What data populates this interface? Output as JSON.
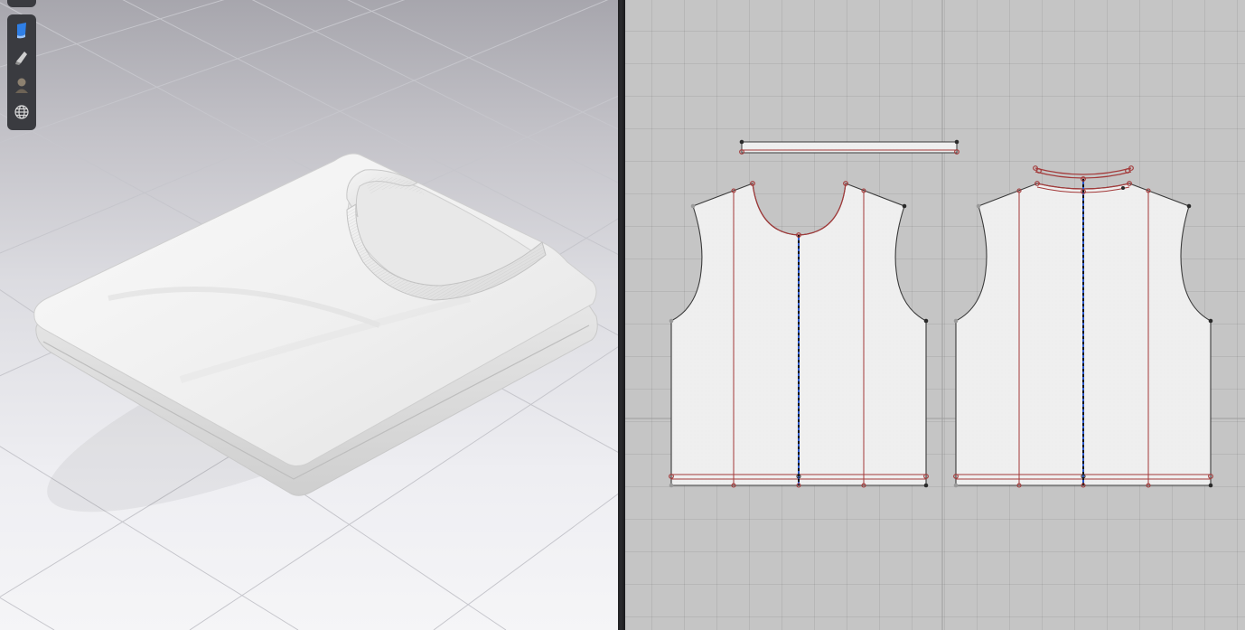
{
  "window": {
    "layout": "split-view",
    "left_pane": "3d-garment-viewport",
    "right_pane": "2d-pattern-window"
  },
  "toolbar3d": {
    "tools": [
      {
        "name": "avatar-display-icon",
        "active": true
      },
      {
        "name": "garment-display-icon",
        "active": false
      },
      {
        "name": "avatar-visibility-icon",
        "active": false
      },
      {
        "name": "environment-globe-icon",
        "active": false
      }
    ]
  },
  "scene3d": {
    "object": "folded-tshirt",
    "fabric_color": "#f2f2f2",
    "floor_grid": true
  },
  "pattern2d": {
    "pieces": [
      {
        "name": "neck-binding-strip"
      },
      {
        "name": "front-body-panel"
      },
      {
        "name": "back-body-panel"
      }
    ],
    "colors": {
      "piece_fill": "#efefef",
      "outline": "#3a3a3a",
      "internal_line": "#a33a3a",
      "grainline": "#2a55c8",
      "point": "#2a2a2a"
    }
  }
}
